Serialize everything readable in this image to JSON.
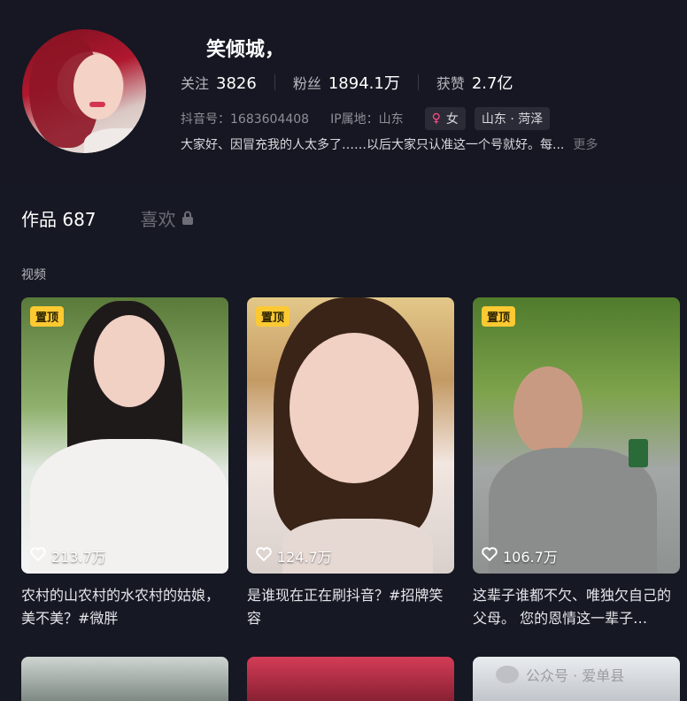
{
  "profile": {
    "name": "笑倾城，",
    "stats": [
      {
        "label": "关注",
        "value": "3826"
      },
      {
        "label": "粉丝",
        "value": "1894.1万"
      },
      {
        "label": "获赞",
        "value": "2.7亿"
      }
    ],
    "douyin_id": "抖音号：1683604408",
    "ip_location": "IP属地：山东",
    "gender_tag": "女",
    "region_tag": "山东 · 菏泽",
    "bio": "大家好、因冒充我的人太多了……以后大家只认准这一个号就好。每...",
    "more": "更多"
  },
  "tabs": {
    "works_label": "作品 687",
    "likes_label": "喜欢"
  },
  "section_label": "视频",
  "videos": [
    {
      "pin": "置顶",
      "likes": "213.7万",
      "caption": "农村的山农村的水农村的姑娘，美不美？#微胖"
    },
    {
      "pin": "置顶",
      "likes": "124.7万",
      "caption": "是谁现在正在刷抖音？#招牌笑容"
    },
    {
      "pin": "置顶",
      "likes": "106.7万",
      "caption": "这辈子谁都不欠、唯独欠自己的父母。 您的恩情这一辈子…"
    }
  ],
  "watermark": "公众号 · 爱单县",
  "colors": {
    "background": "#161823",
    "pin_badge": "#fcc932",
    "female_accent": "#ff4e88"
  }
}
